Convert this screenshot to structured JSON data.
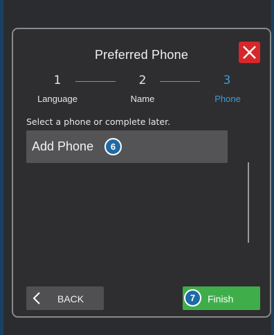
{
  "dialog": {
    "title": "Preferred Phone",
    "close_icon": "close-x-icon"
  },
  "steps": [
    {
      "number": "1",
      "label": "Language",
      "active": false
    },
    {
      "number": "2",
      "label": "Name",
      "active": false
    },
    {
      "number": "3",
      "label": "Phone",
      "active": true
    }
  ],
  "instruction": "Select a phone or complete later.",
  "add_phone": {
    "label": "Add Phone",
    "badge": "6"
  },
  "buttons": {
    "back_label": "BACK",
    "back_icon": "chevron-left-icon",
    "finish_label": "Finish",
    "finish_badge": "7"
  },
  "colors": {
    "accent": "#3d9cd8",
    "close": "#d6282b",
    "finish": "#3fae4a",
    "badge": "#1f6aa5"
  }
}
